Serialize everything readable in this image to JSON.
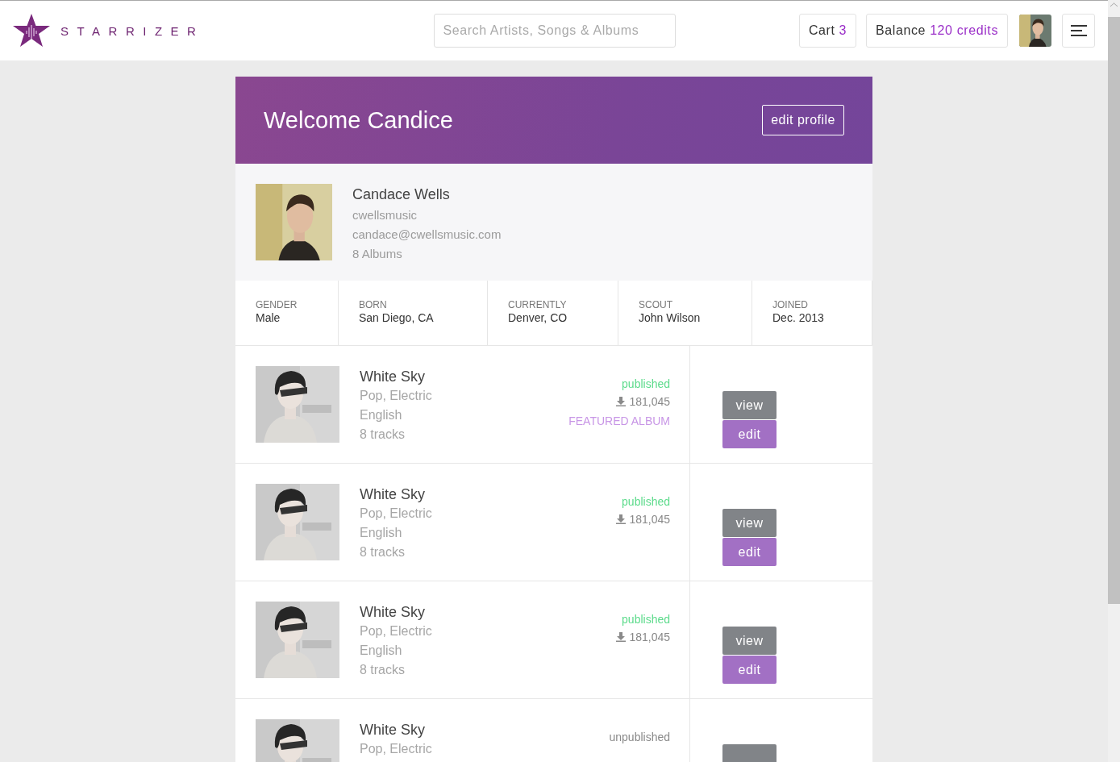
{
  "brand": {
    "name": "STARRIZER"
  },
  "search": {
    "placeholder": "Search Artists, Songs & Albums"
  },
  "cart": {
    "label": "Cart",
    "count": "3"
  },
  "balance": {
    "label": "Balance",
    "amount": "120 credits"
  },
  "profile": {
    "title": "Welcome Candice",
    "edit_button": "edit profile",
    "name": "Candace Wells",
    "username": "cwellsmusic",
    "email": "candace@cwellsmusic.com",
    "albums": "8 Albums",
    "stats": [
      {
        "label": "GENDER",
        "value": "Male"
      },
      {
        "label": "BORN",
        "value": "San Diego, CA"
      },
      {
        "label": "CURRENTLY",
        "value": "Denver, CO"
      },
      {
        "label": "SCOUT",
        "value": "John Wilson"
      },
      {
        "label": "JOINED",
        "value": "Dec. 2013"
      }
    ]
  },
  "albums": [
    {
      "title": "White Sky",
      "genre": "Pop, Electric",
      "language": "English",
      "tracks": "8 tracks",
      "status": "published",
      "published": true,
      "downloads": "181,045",
      "featured_label": "FEATURED ALBUM",
      "view_button": "view",
      "edit_button": "edit"
    },
    {
      "title": "White Sky",
      "genre": "Pop, Electric",
      "language": "English",
      "tracks": "8 tracks",
      "status": "published",
      "published": true,
      "downloads": "181,045",
      "view_button": "view",
      "edit_button": "edit"
    },
    {
      "title": "White Sky",
      "genre": "Pop, Electric",
      "language": "English",
      "tracks": "8 tracks",
      "status": "published",
      "published": true,
      "downloads": "181,045",
      "view_button": "view",
      "edit_button": "edit"
    },
    {
      "title": "White Sky",
      "genre": "Pop, Electric",
      "status": "unpublished",
      "published": false
    }
  ]
}
